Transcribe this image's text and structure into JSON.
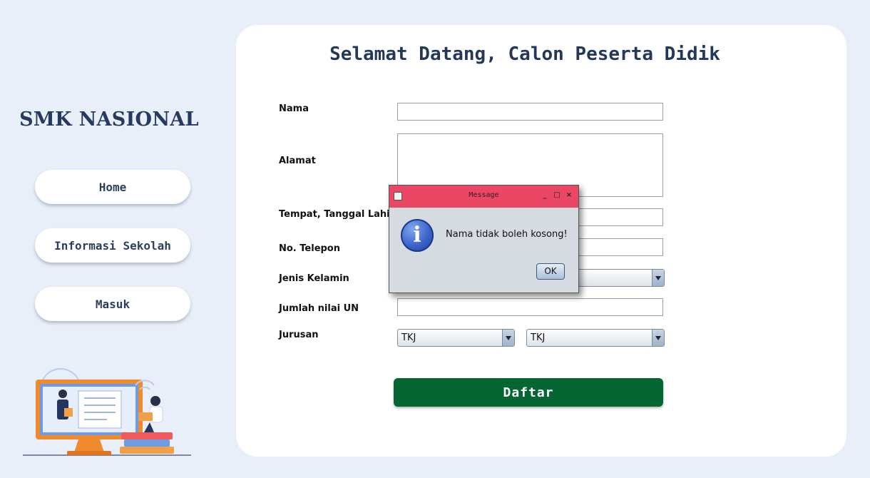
{
  "sidebar": {
    "brand": "SMK NASIONAL",
    "nav": [
      "Home",
      "Informasi Sekolah",
      "Masuk"
    ]
  },
  "form": {
    "title": "Selamat Datang, Calon Peserta Didik",
    "labels": {
      "nama": "Nama",
      "alamat": "Alamat",
      "ttl": "Tempat, Tanggal Lahir",
      "telepon": "No. Telepon",
      "kelamin": "Jenis Kelamin",
      "nilai_un": "Jumlah nilai UN",
      "jurusan": "Jurusan"
    },
    "values": {
      "nama": "",
      "alamat": "",
      "ttl": "",
      "telepon": "",
      "kelamin": "",
      "nilai_un": "",
      "jurusan_1": "TKJ",
      "jurusan_2": "TKJ"
    },
    "submit": "Daftar"
  },
  "dialog": {
    "title": "Message",
    "message": "Nama tidak boleh kosong!",
    "ok": "OK",
    "icon": "info-icon"
  },
  "colors": {
    "page_bg": "#e8eff9",
    "brand_text": "#253a5e",
    "submit_bg": "#056634",
    "dialog_titlebar": "#ea4764"
  }
}
